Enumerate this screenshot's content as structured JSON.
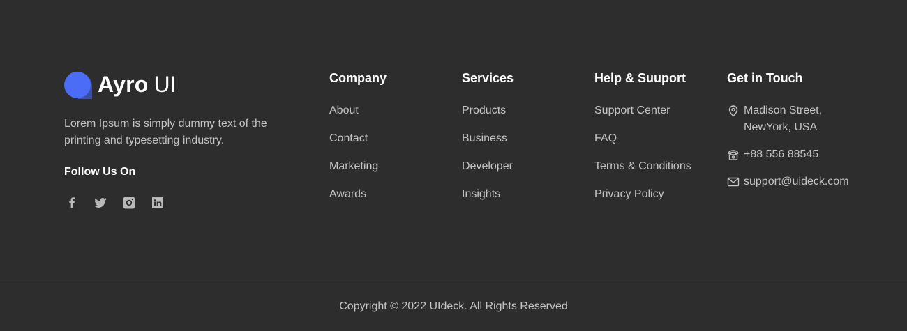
{
  "brand": {
    "name_bold": "Ayro",
    "name_light": "UI",
    "description": "Lorem Ipsum is simply dummy text of the printing and typesetting industry.",
    "follow_title": "Follow Us On",
    "socials": [
      "facebook-icon",
      "twitter-icon",
      "instagram-icon",
      "linkedin-icon"
    ]
  },
  "company": {
    "title": "Company",
    "links": [
      "About",
      "Contact",
      "Marketing",
      "Awards"
    ]
  },
  "services": {
    "title": "Services",
    "links": [
      "Products",
      "Business",
      "Developer",
      "Insights"
    ]
  },
  "help": {
    "title": "Help & Suuport",
    "links": [
      "Support Center",
      "FAQ",
      "Terms & Conditions",
      "Privacy Policy"
    ]
  },
  "contact": {
    "title": "Get in Touch",
    "address_line1": "Madison Street,",
    "address_line2": "NewYork, USA",
    "phone": "+88 556 88545",
    "email": "support@uideck.com"
  },
  "footer": {
    "copyright": "Copyright © 2022 UIdeck. All Rights Reserved"
  },
  "colors": {
    "background": "#2d2d2d",
    "logo_blue": "#4a6cf7",
    "text_muted": "#c4c4c4",
    "heading": "#ffffff"
  }
}
